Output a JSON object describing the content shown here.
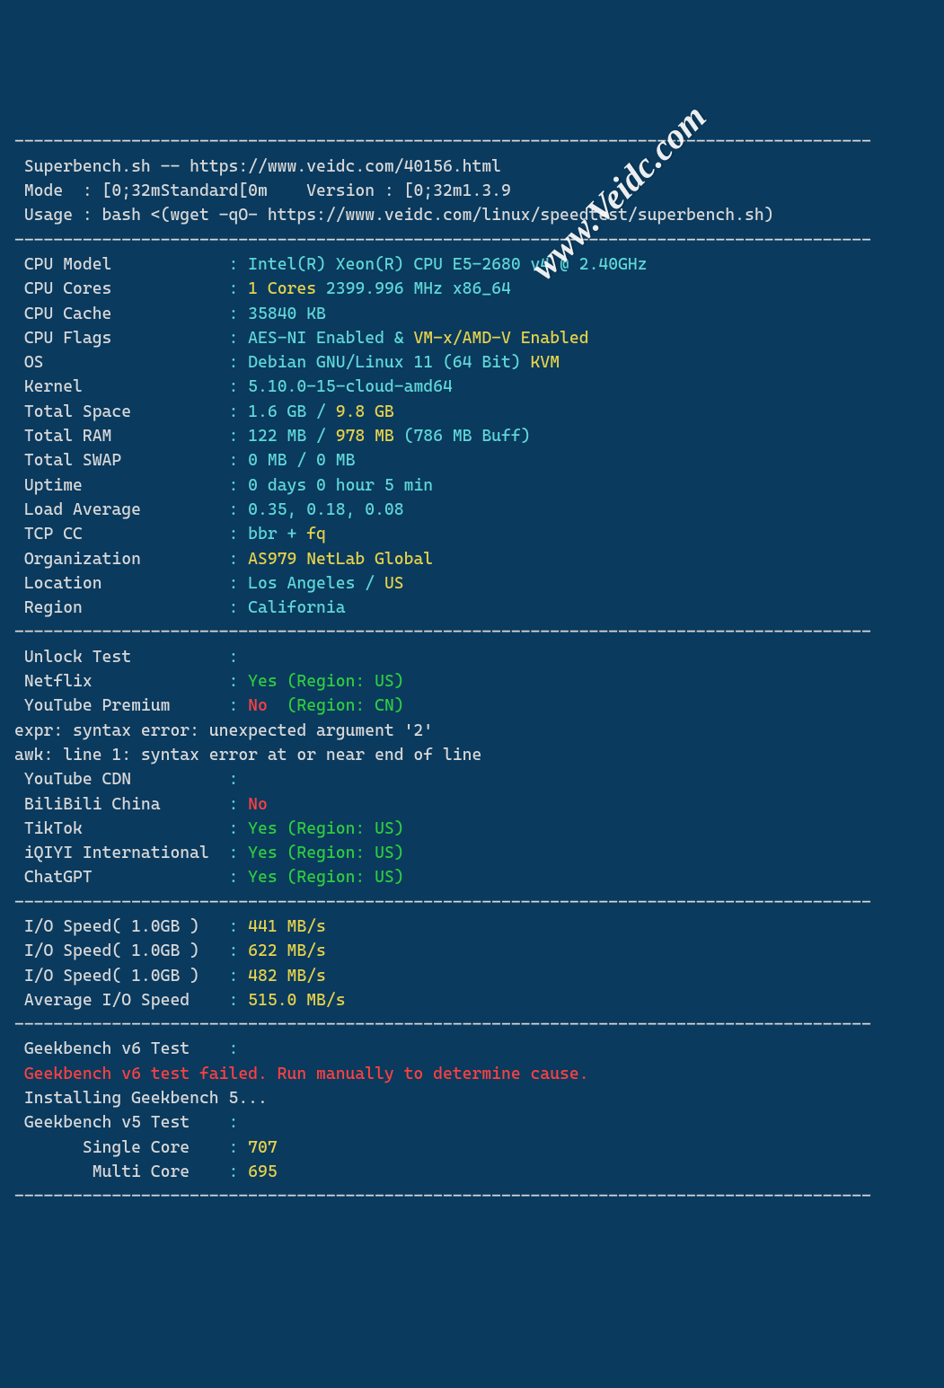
{
  "sep": "----------------------------------------------------------------------------------------",
  "header": {
    "title": " Superbench.sh -- https://www.veidc.com/40156.html",
    "mode_prefix": " Mode  : [0;32m",
    "mode_val": "Standard",
    "mode_suffix": "[0m    Version : [0;32m",
    "version_val": "1.3.9",
    "usage": " Usage : bash <(wget -qO- https://www.veidc.com/linux/speedtest/superbench.sh)"
  },
  "sys": {
    "cpu_model_lbl": " CPU Model            ",
    "cpu_model_val": "Intel(R) Xeon(R) CPU E5-2680 v4 @ 2.40GHz",
    "cpu_cores_lbl": " CPU Cores            ",
    "cpu_cores_a": "1 Cores",
    "cpu_cores_b": " 2399.996 MHz x86_64",
    "cpu_cache_lbl": " CPU Cache            ",
    "cpu_cache_val": "35840 KB",
    "cpu_flags_lbl": " CPU Flags            ",
    "cpu_flags_a": "AES-NI Enabled & ",
    "cpu_flags_b": "VM-x/AMD-V Enabled",
    "os_lbl": " OS                   ",
    "os_a": "Debian GNU/Linux 11 (64 Bit) ",
    "os_b": "KVM",
    "kernel_lbl": " Kernel               ",
    "kernel_val": "5.10.0-15-cloud-amd64",
    "space_lbl": " Total Space          ",
    "space_a": "1.6 GB / ",
    "space_b": "9.8 GB",
    "ram_lbl": " Total RAM            ",
    "ram_a": "122 MB / ",
    "ram_b": "978 MB",
    "ram_c": " (786 MB Buff)",
    "swap_lbl": " Total SWAP           ",
    "swap_val": "0 MB / 0 MB",
    "uptime_lbl": " Uptime               ",
    "uptime_val": "0 days 0 hour 5 min",
    "load_lbl": " Load Average         ",
    "load_val": "0.35, 0.18, 0.08",
    "tcp_lbl": " TCP CC               ",
    "tcp_a": "bbr + ",
    "tcp_b": "fq",
    "org_lbl": " Organization         ",
    "org_val": "AS979 NetLab Global",
    "loc_lbl": " Location             ",
    "loc_a": "Los Angeles / ",
    "loc_b": "US",
    "region_lbl": " Region               ",
    "region_val": "California"
  },
  "unlock": {
    "title_lbl": " Unlock Test          ",
    "netflix_lbl": " Netflix              ",
    "netflix_a": "Yes",
    "netflix_b": " (Region: US)",
    "yt_prem_lbl": " YouTube Premium      ",
    "yt_prem_a": "No ",
    "yt_prem_b": " (Region: CN)",
    "err1": "expr: syntax error: unexpected argument '2'",
    "err2": "awk: line 1: syntax error at or near end of line",
    "yt_cdn_lbl": " YouTube CDN          ",
    "bili_lbl": " BiliBili China       ",
    "bili_val": "No",
    "tiktok_lbl": " TikTok               ",
    "tiktok_a": "Yes",
    "tiktok_b": " (Region: US)",
    "iqiyi_lbl": " iQIYI International  ",
    "iqiyi_a": "Yes",
    "iqiyi_b": " (Region: US)",
    "gpt_lbl": " ChatGPT              ",
    "gpt_a": "Yes",
    "gpt_b": " (Region: US)"
  },
  "io": {
    "r1_lbl": " I/O Speed( 1.0GB )   ",
    "r1_val": "441 MB/s",
    "r2_lbl": " I/O Speed( 1.0GB )   ",
    "r2_val": "622 MB/s",
    "r3_lbl": " I/O Speed( 1.0GB )   ",
    "r3_val": "482 MB/s",
    "avg_lbl": " Average I/O Speed    ",
    "avg_val": "515.0 MB/s"
  },
  "geek": {
    "v6_lbl": " Geekbench v6 Test    ",
    "v6_fail": " Geekbench v6 test failed. Run manually to determine cause.",
    "install": " Installing Geekbench 5...",
    "v5_lbl": " Geekbench v5 Test    ",
    "single_lbl": "       Single Core    ",
    "single_val": "707",
    "multi_lbl": "        Multi Core    ",
    "multi_val": "695"
  },
  "watermark": "www.Veidc.com"
}
